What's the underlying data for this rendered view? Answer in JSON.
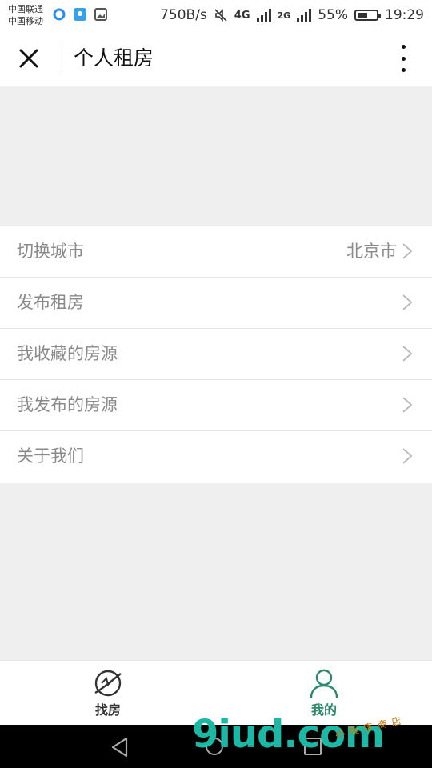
{
  "status_bar": {
    "carrier1": "中国联通",
    "carrier2": "中国移动",
    "speed": "750B/s",
    "net1": "4G",
    "net2": "2G",
    "battery": "55%",
    "battery_level": 0.55,
    "time": "19:29"
  },
  "navbar": {
    "title": "个人租房"
  },
  "menu": {
    "items": [
      {
        "label": "切换城市",
        "value": "北京市"
      },
      {
        "label": "发布租房",
        "value": ""
      },
      {
        "label": "我收藏的房源",
        "value": ""
      },
      {
        "label": "我发布的房源",
        "value": ""
      },
      {
        "label": "关于我们",
        "value": ""
      }
    ]
  },
  "tabbar": {
    "tabs": [
      {
        "label": "找房",
        "icon": "planet-icon",
        "active": false
      },
      {
        "label": "我的",
        "icon": "person-icon",
        "active": true
      }
    ],
    "active_color": "#2b8a6a",
    "inactive_color": "#333333"
  },
  "watermark": {
    "text": "9iud.com",
    "sub": "小程序商店"
  }
}
